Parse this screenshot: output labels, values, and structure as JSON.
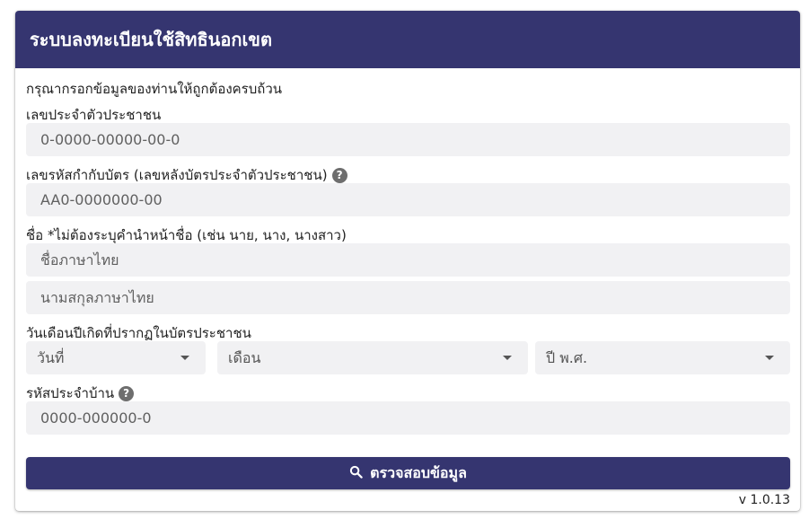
{
  "header": {
    "title": "ระบบลงทะเบียนใช้สิทธินอกเขต"
  },
  "form": {
    "intro": "กรุณากรอกข้อมูลของท่านให้ถูกต้องครบถ้วน",
    "id_label": "เลขประจำตัวประชาชน",
    "id_placeholder": "0-0000-00000-00-0",
    "laser_label": "เลขรหัสกำกับบัตร (เลขหลังบัตรประจำตัวประชาชน)",
    "laser_placeholder": "AA0-0000000-00",
    "name_label": "ชื่อ *ไม่ต้องระบุคำนำหน้าชื่อ (เช่น นาย, นาง, นางสาว)",
    "firstname_placeholder": "ชื่อภาษาไทย",
    "lastname_placeholder": "นามสกุลภาษาไทย",
    "birth_label": "วันเดือนปีเกิดที่ปรากฏในบัตรประชาชน",
    "day_select": "วันที่",
    "month_select": "เดือน",
    "year_select": "ปี พ.ศ.",
    "house_label": "รหัสประจำบ้าน",
    "house_placeholder": "0000-000000-0",
    "help_glyph": "?",
    "submit_label": "ตรวจสอบข้อมูล"
  },
  "icons": {
    "help": "question-circle-icon",
    "search": "search-icon",
    "dropdown": "caret-down-icon"
  },
  "colors": {
    "primary": "#353570",
    "field_bg": "#f1f1f3"
  },
  "footer": {
    "version": "v 1.0.13"
  }
}
